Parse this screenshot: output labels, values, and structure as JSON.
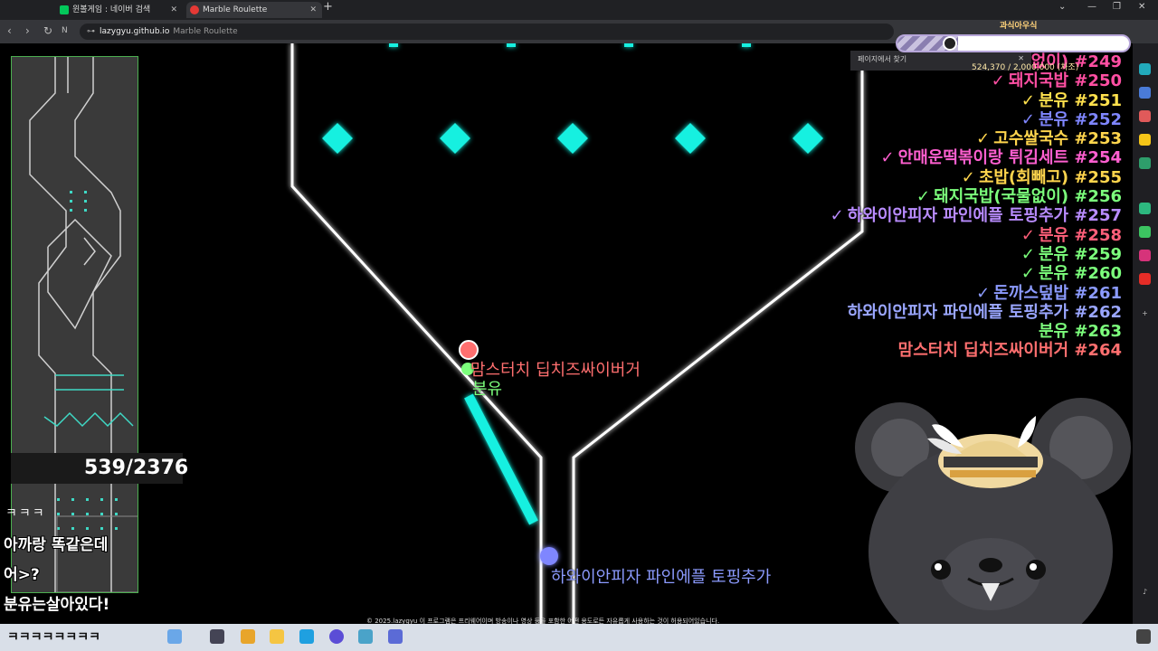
{
  "browser": {
    "tabs": [
      {
        "label": "윈볼게임 : 네이버 검색",
        "color": "#03c75a"
      },
      {
        "label": "Marble Roulette",
        "color": "#e53935"
      }
    ],
    "url_host": "lazygyu.github.io",
    "url_title": "Marble Roulette"
  },
  "donation": {
    "title": "과식아우식",
    "amount": "524,370 / 2,000,000 (차조)",
    "progress": 0.26,
    "find_label": "페이지에서 찾기"
  },
  "ranking": [
    {
      "check": true,
      "text": "돼지국밥(국물없이) #249",
      "color": "#ff4fa3"
    },
    {
      "check": true,
      "text": "돼지국밥 #250",
      "color": "#ff4fa3"
    },
    {
      "check": true,
      "text": "분유 #251",
      "color": "#ffe14d"
    },
    {
      "check": true,
      "text": "분유 #252",
      "color": "#7f86ff"
    },
    {
      "check": true,
      "text": "고수쌀국수 #253",
      "color": "#ffd54d"
    },
    {
      "check": true,
      "text": "안매운떡볶이랑 튀김세트 #254",
      "color": "#ff5fd0"
    },
    {
      "check": true,
      "text": "초밥(회빼고) #255",
      "color": "#ffd54d"
    },
    {
      "check": true,
      "text": "돼지국밥(국물없이) #256",
      "color": "#7cff7c"
    },
    {
      "check": true,
      "text": "하와이안피자 파인에플 토핑추가 #257",
      "color": "#b98cff"
    },
    {
      "check": true,
      "text": "분유 #258",
      "color": "#ff5f7a"
    },
    {
      "check": true,
      "text": "분유 #259",
      "color": "#7cff7c"
    },
    {
      "check": true,
      "text": "분유 #260",
      "color": "#7cff7c"
    },
    {
      "check": true,
      "text": "돈까스덮밥 #261",
      "color": "#8c9bff"
    },
    {
      "check": false,
      "text": "하와이안피자 파인에플 토핑추가 #262",
      "color": "#9aa6ff"
    },
    {
      "check": false,
      "text": "분유 #263",
      "color": "#7cff7c"
    },
    {
      "check": false,
      "text": "맘스터치 딥치즈싸이버거 #264",
      "color": "#ff6f6f"
    }
  ],
  "marbles": [
    {
      "label": "맘스터치 딥치즈싸이버거",
      "color": "#ff6f6f"
    },
    {
      "label": "분유",
      "color": "#7cff7c"
    },
    {
      "label": "하와이안피자 파인에플 토핑추가",
      "color": "#8c9bff"
    }
  ],
  "counter": "539/2376",
  "chat": [
    "아까랑 똑같은데",
    "어>?",
    "분유는살아있다!"
  ],
  "chat_kkk": "ㅋㅋㅋ",
  "footer": "© 2025.lazygyu 이 프로그램은 프리웨어이며 방송이나 영상 등을 포함한 어떤 용도로든 자유롭게 사용하는 것이 허용되어있습니다.",
  "taskbar_text": "ㅋㅋㅋㅋㅋㅋㅋㅋ",
  "colors": {
    "neon": "#00e5d0",
    "wall": "#ffffff"
  }
}
